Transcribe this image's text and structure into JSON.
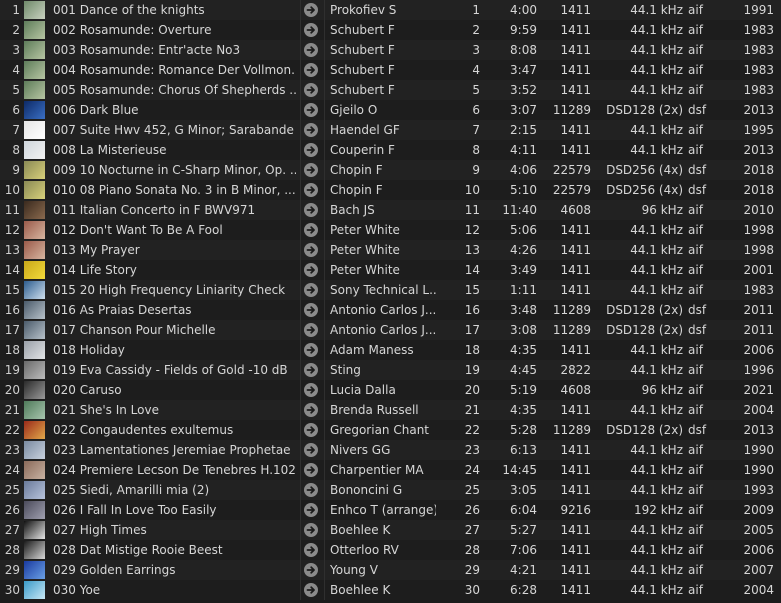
{
  "rows": [
    {
      "num": "1",
      "title": "001 Dance of the knights",
      "artist": "Prokofiev S",
      "track": "1",
      "time": "4:00",
      "bitrate": "1411",
      "freq": "44.1 kHz",
      "format": "aif",
      "year": "1991",
      "c1": "#6f8a6a",
      "c2": "#c9d2c0"
    },
    {
      "num": "2",
      "title": "002 Rosamunde: Overture",
      "artist": "Schubert F",
      "track": "2",
      "time": "9:59",
      "bitrate": "1411",
      "freq": "44.1 kHz",
      "format": "aif",
      "year": "1983",
      "c1": "#5e7d5a",
      "c2": "#b7c6a3"
    },
    {
      "num": "3",
      "title": "003 Rosamunde: Entr'acte No3",
      "artist": "Schubert F",
      "track": "3",
      "time": "8:08",
      "bitrate": "1411",
      "freq": "44.1 kHz",
      "format": "aif",
      "year": "1983",
      "c1": "#5e7d5a",
      "c2": "#b7c6a3"
    },
    {
      "num": "4",
      "title": "004 Rosamunde: Romance Der Vollmon...",
      "artist": "Schubert F",
      "track": "4",
      "time": "3:47",
      "bitrate": "1411",
      "freq": "44.1 kHz",
      "format": "aif",
      "year": "1983",
      "c1": "#5e7d5a",
      "c2": "#b7c6a3"
    },
    {
      "num": "5",
      "title": "005 Rosamunde: Chorus Of Shepherds ...",
      "artist": "Schubert F",
      "track": "5",
      "time": "3:52",
      "bitrate": "1411",
      "freq": "44.1 kHz",
      "format": "aif",
      "year": "1983",
      "c1": "#5e7d5a",
      "c2": "#b7c6a3"
    },
    {
      "num": "6",
      "title": "006 Dark Blue",
      "artist": "Gjeilo O",
      "track": "6",
      "time": "3:07",
      "bitrate": "11289",
      "freq": "DSD128 (2x)",
      "format": "dsf",
      "year": "2013",
      "c1": "#0d2a66",
      "c2": "#3a6fc4"
    },
    {
      "num": "7",
      "title": "007 Suite Hwv 452, G Minor; Sarabande",
      "artist": "Haendel GF",
      "track": "7",
      "time": "2:15",
      "bitrate": "1411",
      "freq": "44.1 kHz",
      "format": "aif",
      "year": "1995",
      "c1": "#e6e6e6",
      "c2": "#ffffff"
    },
    {
      "num": "8",
      "title": "008 La Misterieuse",
      "artist": "Couperin F",
      "track": "8",
      "time": "4:11",
      "bitrate": "1411",
      "freq": "44.1 kHz",
      "format": "aif",
      "year": "2013",
      "c1": "#cfd6dc",
      "c2": "#f2f2f2"
    },
    {
      "num": "9",
      "title": "009 10 Nocturne in C-Sharp Minor, Op. ...",
      "artist": "Chopin F",
      "track": "9",
      "time": "4:06",
      "bitrate": "22579",
      "freq": "DSD256 (4x)",
      "format": "dsf",
      "year": "2018",
      "c1": "#8a8a55",
      "c2": "#d8d07a"
    },
    {
      "num": "10",
      "title": "010 08 Piano Sonata No. 3 in B Minor, ...",
      "artist": "Chopin F",
      "track": "10",
      "time": "5:10",
      "bitrate": "22579",
      "freq": "DSD256 (4x)",
      "format": "dsf",
      "year": "2018",
      "c1": "#8a8a55",
      "c2": "#d8d07a"
    },
    {
      "num": "11",
      "title": "011 Italian Concerto in F BWV971",
      "artist": "Bach JS",
      "track": "11",
      "time": "11:40",
      "bitrate": "4608",
      "freq": "96 kHz",
      "format": "aif",
      "year": "2010",
      "c1": "#3a2a1e",
      "c2": "#8a6a4e"
    },
    {
      "num": "12",
      "title": "012 Don't Want To Be A Fool",
      "artist": "Peter White",
      "track": "12",
      "time": "5:06",
      "bitrate": "1411",
      "freq": "44.1 kHz",
      "format": "aif",
      "year": "1998",
      "c1": "#9a5a4a",
      "c2": "#d8b6a0"
    },
    {
      "num": "13",
      "title": "013 My Prayer",
      "artist": "Peter White",
      "track": "13",
      "time": "4:26",
      "bitrate": "1411",
      "freq": "44.1 kHz",
      "format": "aif",
      "year": "1998",
      "c1": "#9a5a4a",
      "c2": "#d8b6a0"
    },
    {
      "num": "14",
      "title": "014 Life Story",
      "artist": "Peter White",
      "track": "14",
      "time": "3:49",
      "bitrate": "1411",
      "freq": "44.1 kHz",
      "format": "aif",
      "year": "2001",
      "c1": "#c9a81a",
      "c2": "#f2da3a"
    },
    {
      "num": "15",
      "title": "015 20 High Frequency Liniarity Check",
      "artist": "Sony Technical L...",
      "track": "15",
      "time": "1:11",
      "bitrate": "1411",
      "freq": "44.1 kHz",
      "format": "aif",
      "year": "1983",
      "c1": "#2d5d8f",
      "c2": "#cfe0ee"
    },
    {
      "num": "16",
      "title": "016 As Praias Desertas",
      "artist": "Antonio Carlos J...",
      "track": "16",
      "time": "3:48",
      "bitrate": "11289",
      "freq": "DSD128 (2x)",
      "format": "dsf",
      "year": "2011",
      "c1": "#4a5a6a",
      "c2": "#b8c2ca"
    },
    {
      "num": "17",
      "title": "017 Chanson Pour Michelle",
      "artist": "Antonio Carlos J...",
      "track": "17",
      "time": "3:08",
      "bitrate": "11289",
      "freq": "DSD128 (2x)",
      "format": "dsf",
      "year": "2011",
      "c1": "#4a5a6a",
      "c2": "#b8c2ca"
    },
    {
      "num": "18",
      "title": "018 Holiday",
      "artist": "Adam Maness",
      "track": "18",
      "time": "4:35",
      "bitrate": "1411",
      "freq": "44.1 kHz",
      "format": "aif",
      "year": "2006",
      "c1": "#9aa0a8",
      "c2": "#e2e4e6"
    },
    {
      "num": "19",
      "title": "019 Eva Cassidy - Fields of Gold -10 dB",
      "artist": "Sting",
      "track": "19",
      "time": "4:45",
      "bitrate": "2822",
      "freq": "44.1 kHz",
      "format": "aif",
      "year": "1996",
      "c1": "#6a6a6a",
      "c2": "#bdbdbd"
    },
    {
      "num": "20",
      "title": "020 Caruso",
      "artist": "Lucia Dalla",
      "track": "20",
      "time": "5:19",
      "bitrate": "4608",
      "freq": "96 kHz",
      "format": "aif",
      "year": "2021",
      "c1": "#2a2a2a",
      "c2": "#9a9a9a"
    },
    {
      "num": "21",
      "title": "021 She's In Love",
      "artist": "Brenda Russell",
      "track": "21",
      "time": "4:35",
      "bitrate": "1411",
      "freq": "44.1 kHz",
      "format": "aif",
      "year": "2004",
      "c1": "#4f7a5a",
      "c2": "#a8c6ae"
    },
    {
      "num": "22",
      "title": "022 Congaudentes exultemus",
      "artist": "Gregorian Chant",
      "track": "22",
      "time": "5:28",
      "bitrate": "11289",
      "freq": "DSD128 (2x)",
      "format": "dsf",
      "year": "2013",
      "c1": "#9a2a1a",
      "c2": "#e2a84a"
    },
    {
      "num": "23",
      "title": "023 Lamentationes Jeremiae Prophetae",
      "artist": "Nivers GG",
      "track": "23",
      "time": "6:13",
      "bitrate": "1411",
      "freq": "44.1 kHz",
      "format": "aif",
      "year": "1990",
      "c1": "#7a8aa0",
      "c2": "#c9d2de"
    },
    {
      "num": "24",
      "title": "024 Premiere Lecson De Tenebres H.102",
      "artist": "Charpentier MA",
      "track": "24",
      "time": "14:45",
      "bitrate": "1411",
      "freq": "44.1 kHz",
      "format": "aif",
      "year": "1990",
      "c1": "#8a6a5a",
      "c2": "#c9b2a2"
    },
    {
      "num": "25",
      "title": "025 Siedi, Amarilli mia (2)",
      "artist": "Bononcini G",
      "track": "25",
      "time": "3:05",
      "bitrate": "1411",
      "freq": "44.1 kHz",
      "format": "aif",
      "year": "1993",
      "c1": "#6a7a9a",
      "c2": "#b8c4dc"
    },
    {
      "num": "26",
      "title": "026 I Fall In Love Too Easily",
      "artist": "Enhco T (arrange)",
      "track": "26",
      "time": "6:04",
      "bitrate": "9216",
      "freq": "192 kHz",
      "format": "aif",
      "year": "2009",
      "c1": "#4a4a5a",
      "c2": "#a0a0b0"
    },
    {
      "num": "27",
      "title": "027 High Times",
      "artist": "Boehlee K",
      "track": "27",
      "time": "5:27",
      "bitrate": "1411",
      "freq": "44.1 kHz",
      "format": "aif",
      "year": "2005",
      "c1": "#111111",
      "c2": "#e6e6e6"
    },
    {
      "num": "28",
      "title": "028 Dat Mistige Rooie Beest",
      "artist": "Otterloo RV",
      "track": "28",
      "time": "7:06",
      "bitrate": "1411",
      "freq": "44.1 kHz",
      "format": "aif",
      "year": "2006",
      "c1": "#1a1a1a",
      "c2": "#d8d8d8"
    },
    {
      "num": "29",
      "title": "029 Golden Earrings",
      "artist": "Young V",
      "track": "29",
      "time": "4:21",
      "bitrate": "1411",
      "freq": "44.1 kHz",
      "format": "aif",
      "year": "2007",
      "c1": "#1a3aa0",
      "c2": "#6aa0e6"
    },
    {
      "num": "30",
      "title": "030 Yoe",
      "artist": "Boehlee K",
      "track": "30",
      "time": "6:28",
      "bitrate": "1411",
      "freq": "44.1 kHz",
      "format": "aif",
      "year": "2004",
      "c1": "#3a9ac8",
      "c2": "#c8e8f6"
    }
  ],
  "icons": {
    "go": "arrow-right-circle-icon",
    "thumb": "album-art-thumbnail"
  }
}
